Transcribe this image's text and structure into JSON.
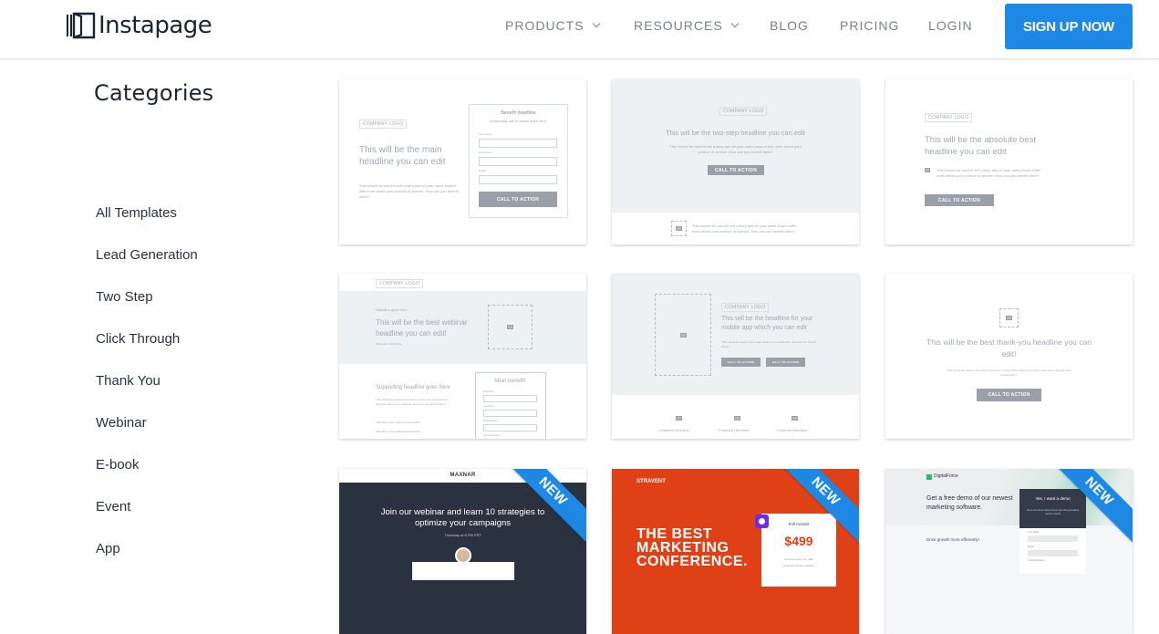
{
  "header": {
    "logo_text": "Instapage",
    "nav": [
      {
        "label": "PRODUCTS",
        "has_dropdown": true
      },
      {
        "label": "RESOURCES",
        "has_dropdown": true
      },
      {
        "label": "BLOG",
        "has_dropdown": false
      },
      {
        "label": "PRICING",
        "has_dropdown": false
      },
      {
        "label": "LOGIN",
        "has_dropdown": false
      }
    ],
    "cta_label": "SIGN UP NOW",
    "cta_color": "#1e88e5"
  },
  "sidebar": {
    "title": "Categories",
    "items": [
      {
        "label": "All Templates"
      },
      {
        "label": "Lead Generation"
      },
      {
        "label": "Two Step"
      },
      {
        "label": "Click Through"
      },
      {
        "label": "Thank You"
      },
      {
        "label": "Webinar"
      },
      {
        "label": "E-book"
      },
      {
        "label": "Event"
      },
      {
        "label": "App"
      }
    ]
  },
  "templates": [
    {
      "logo": "COMPANY LOGO",
      "headline": "This will be the main headline you can edit",
      "body": "This should be used to tell a story and let your users know a little more about your product or service. How can you benefit them?",
      "form_title": "Benefit headline",
      "form_subtitle": "Supporting call-to-action goes here.",
      "fields": [
        "First name",
        "Last name",
        "Email"
      ],
      "cta": "CALL TO ACTION"
    },
    {
      "logo": "COMPANY LOGO",
      "headline": "This will be the two-step headline you can edit",
      "body": "This should be used to tell a story and let your users know a little more about your product or service. How can you benefit them?",
      "cta": "CALL TO ACTION",
      "footer_text": "This should be used to tell a story and let your users know a little more about your product or service. How can you benefit them?"
    },
    {
      "logo": "COMPANY LOGO",
      "headline": "This will be the absolute best headline you can edit",
      "body": "This should be used to tell a story and let your users know a little more about your product or service. How can you benefit them?",
      "cta": "CALL TO ACTION"
    },
    {
      "logo": "COMPANY LOGO",
      "eyebrow": "Headline goes here",
      "headline": "This will be the best webinar headline you can edit!",
      "presenter": "Presenter: Full Name",
      "sub_headline": "Supporting headline goes here",
      "body": "This should be used to tell a story and let your users know a little more about your webinar. How can you benefit them?",
      "bullets": [
        "Talk about your webinar and benefits",
        "Talk about your webinar and benefits"
      ],
      "form_title": "Main benefit!",
      "fields": [
        "First Name",
        "Last Name",
        "Email Address",
        "Company Name"
      ]
    },
    {
      "logo": "COMPANY LOGO",
      "headline": "This will be the headline for your mobile app which you can edit",
      "body": "This should be used to tell a story about your mobile app. How can you benefit them?",
      "ctas": [
        "CALL TO ACTION",
        "CALL TO ACTION"
      ],
      "features": [
        "Featured Headline",
        "Featured Headline",
        "Featured Headline"
      ]
    },
    {
      "headline": "This will be the best thank-you headline you can edit!",
      "body": "This should be used to tell a story and let your users know a little more about your event. How can you benefit them?",
      "cta": "CALL TO ACTION"
    },
    {
      "brand": "MAXNAR",
      "headline": "Join our webinar and learn 10 strategies to optimize your campaigns",
      "date": "Thursday at 6 PM PST",
      "badge": "NEW"
    },
    {
      "brand": "STRAVENT",
      "headline": "THE BEST MARKETING CONFERENCE.",
      "ticket_title": "Full Access",
      "price": "$499",
      "ticket_lines": [
        "Access to all of our talks",
        "Food and drinks included"
      ],
      "badge": "NEW"
    },
    {
      "brand": "DigitalForce",
      "headline": "Get a free demo of our newest marketing software.",
      "panel_title": "Yes, I want a demo",
      "panel_text": "Get a free demo today and you can start generating custom reports!",
      "sub_headline": "Drive growth more efficiently!",
      "fields": [
        "Your Name",
        "Email",
        "Company Name"
      ],
      "badge": "NEW"
    }
  ]
}
